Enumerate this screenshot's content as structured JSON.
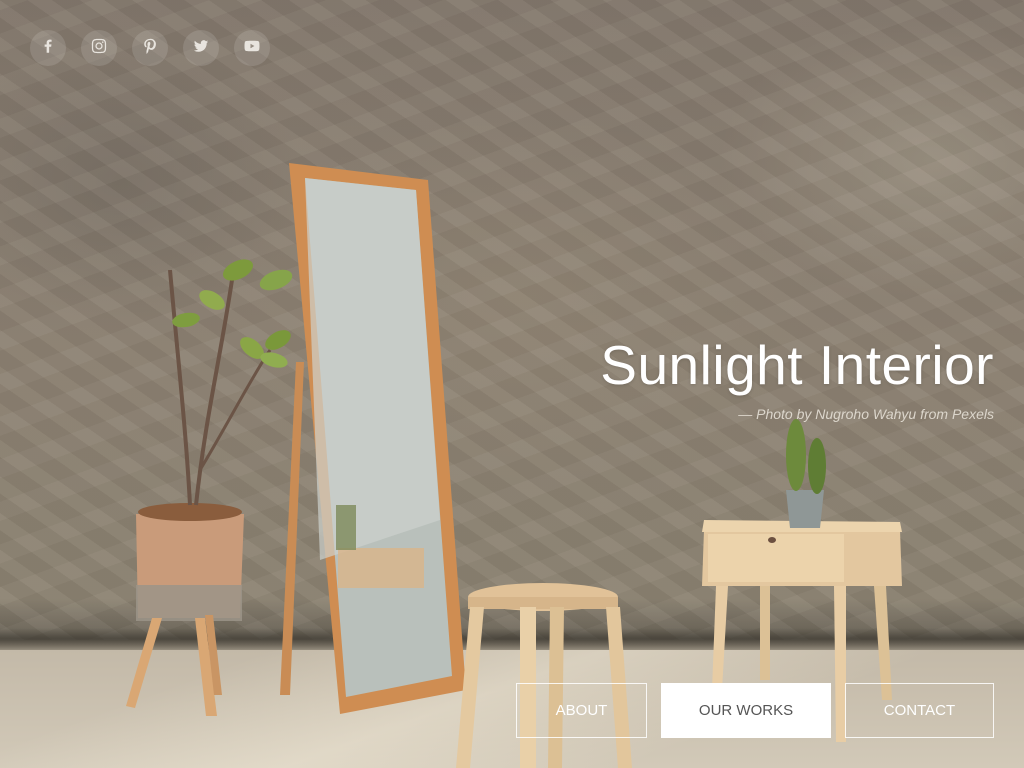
{
  "social": [
    {
      "name": "facebook-icon"
    },
    {
      "name": "instagram-icon"
    },
    {
      "name": "pinterest-icon"
    },
    {
      "name": "twitter-icon"
    },
    {
      "name": "youtube-icon"
    }
  ],
  "hero": {
    "title": "Sunlight Interior",
    "credit": "— Photo by Nugroho Wahyu from Pexels"
  },
  "nav": {
    "about": "ABOUT",
    "our_works": "OUR WORKS",
    "contact": "CONTACT"
  },
  "colors": {
    "wall": "#8a7f70",
    "wood": "#d4a06a",
    "button_active_bg": "#ffffff",
    "button_active_text": "#555555"
  }
}
